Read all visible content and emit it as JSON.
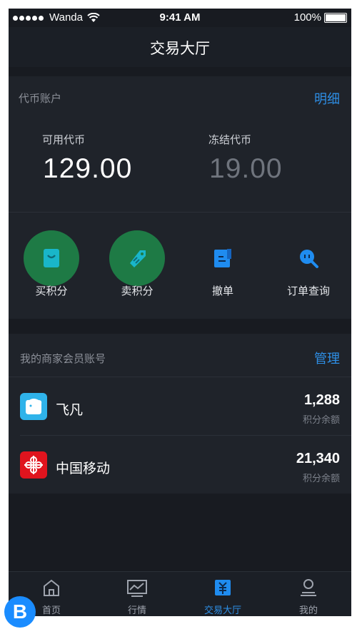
{
  "status_bar": {
    "carrier": "Wanda",
    "time": "9:41 AM",
    "battery": "100%"
  },
  "header": {
    "title": "交易大厅"
  },
  "account": {
    "title": "代币账户",
    "detail_link": "明细",
    "available_label": "可用代币",
    "available_value": "129.00",
    "frozen_label": "冻结代币",
    "frozen_value": "19.00"
  },
  "actions": [
    {
      "label": "买积分",
      "icon": "shopping-bag-icon",
      "highlighted": true
    },
    {
      "label": "卖积分",
      "icon": "price-tag-icon",
      "highlighted": true
    },
    {
      "label": "撤单",
      "icon": "cancel-order-icon",
      "highlighted": false
    },
    {
      "label": "订单查询",
      "icon": "search-icon",
      "highlighted": false
    }
  ],
  "merchants": {
    "title": "我的商家会员账号",
    "manage_link": "管理",
    "items": [
      {
        "name": "飞凡",
        "amount": "1,288",
        "sub": "积分余额",
        "icon": "feifan-logo-icon"
      },
      {
        "name": "中国移动",
        "amount": "21,340",
        "sub": "积分余额",
        "icon": "china-mobile-logo-icon"
      }
    ]
  },
  "tabbar": [
    {
      "label": "首页",
      "icon": "home-icon",
      "active": false
    },
    {
      "label": "行情",
      "icon": "chart-icon",
      "active": false
    },
    {
      "label": "交易大厅",
      "icon": "trade-icon",
      "active": true
    },
    {
      "label": "我的",
      "icon": "user-icon",
      "active": false
    }
  ],
  "badge": "B",
  "colors": {
    "accent": "#2e8fe6",
    "highlight": "#1e7a45",
    "background": "#181b21",
    "card": "#1f232a"
  }
}
